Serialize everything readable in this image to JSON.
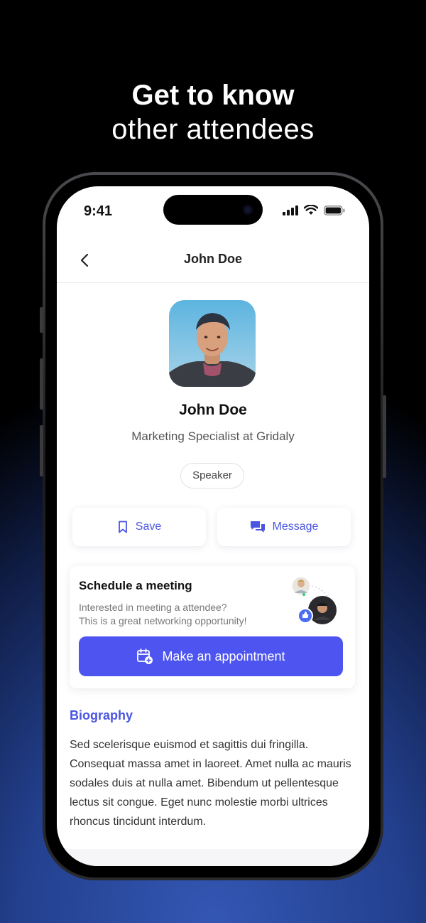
{
  "headline": {
    "line1": "Get to know",
    "line2": "other attendees"
  },
  "status_bar": {
    "time": "9:41"
  },
  "nav": {
    "title": "John Doe"
  },
  "profile": {
    "name": "John Doe",
    "role": "Marketing Specialist at Gridaly",
    "tag": "Speaker"
  },
  "actions": {
    "save_label": "Save",
    "message_label": "Message"
  },
  "schedule": {
    "title": "Schedule a meeting",
    "subtitle_line1": "Interested in meeting a attendee?",
    "subtitle_line2": "This is a great networking opportunity!",
    "cta_label": "Make an appointment"
  },
  "biography": {
    "title": "Biography",
    "text": "Sed scelerisque euismod et sagittis dui fringilla. Consequat massa amet in laoreet. Amet nulla ac mauris sodales duis at nulla amet. Bibendum ut pellentesque lectus sit congue. Eget nunc molestie morbi ultrices rhoncus tincidunt interdum."
  },
  "colors": {
    "accent": "#4d54ef",
    "link": "#4a55e0"
  },
  "icons": [
    "chevron-left-icon",
    "signal-icon",
    "wifi-icon",
    "battery-icon",
    "bookmark-icon",
    "chat-bubbles-icon",
    "calendar-plus-icon",
    "thumbs-up-icon"
  ]
}
